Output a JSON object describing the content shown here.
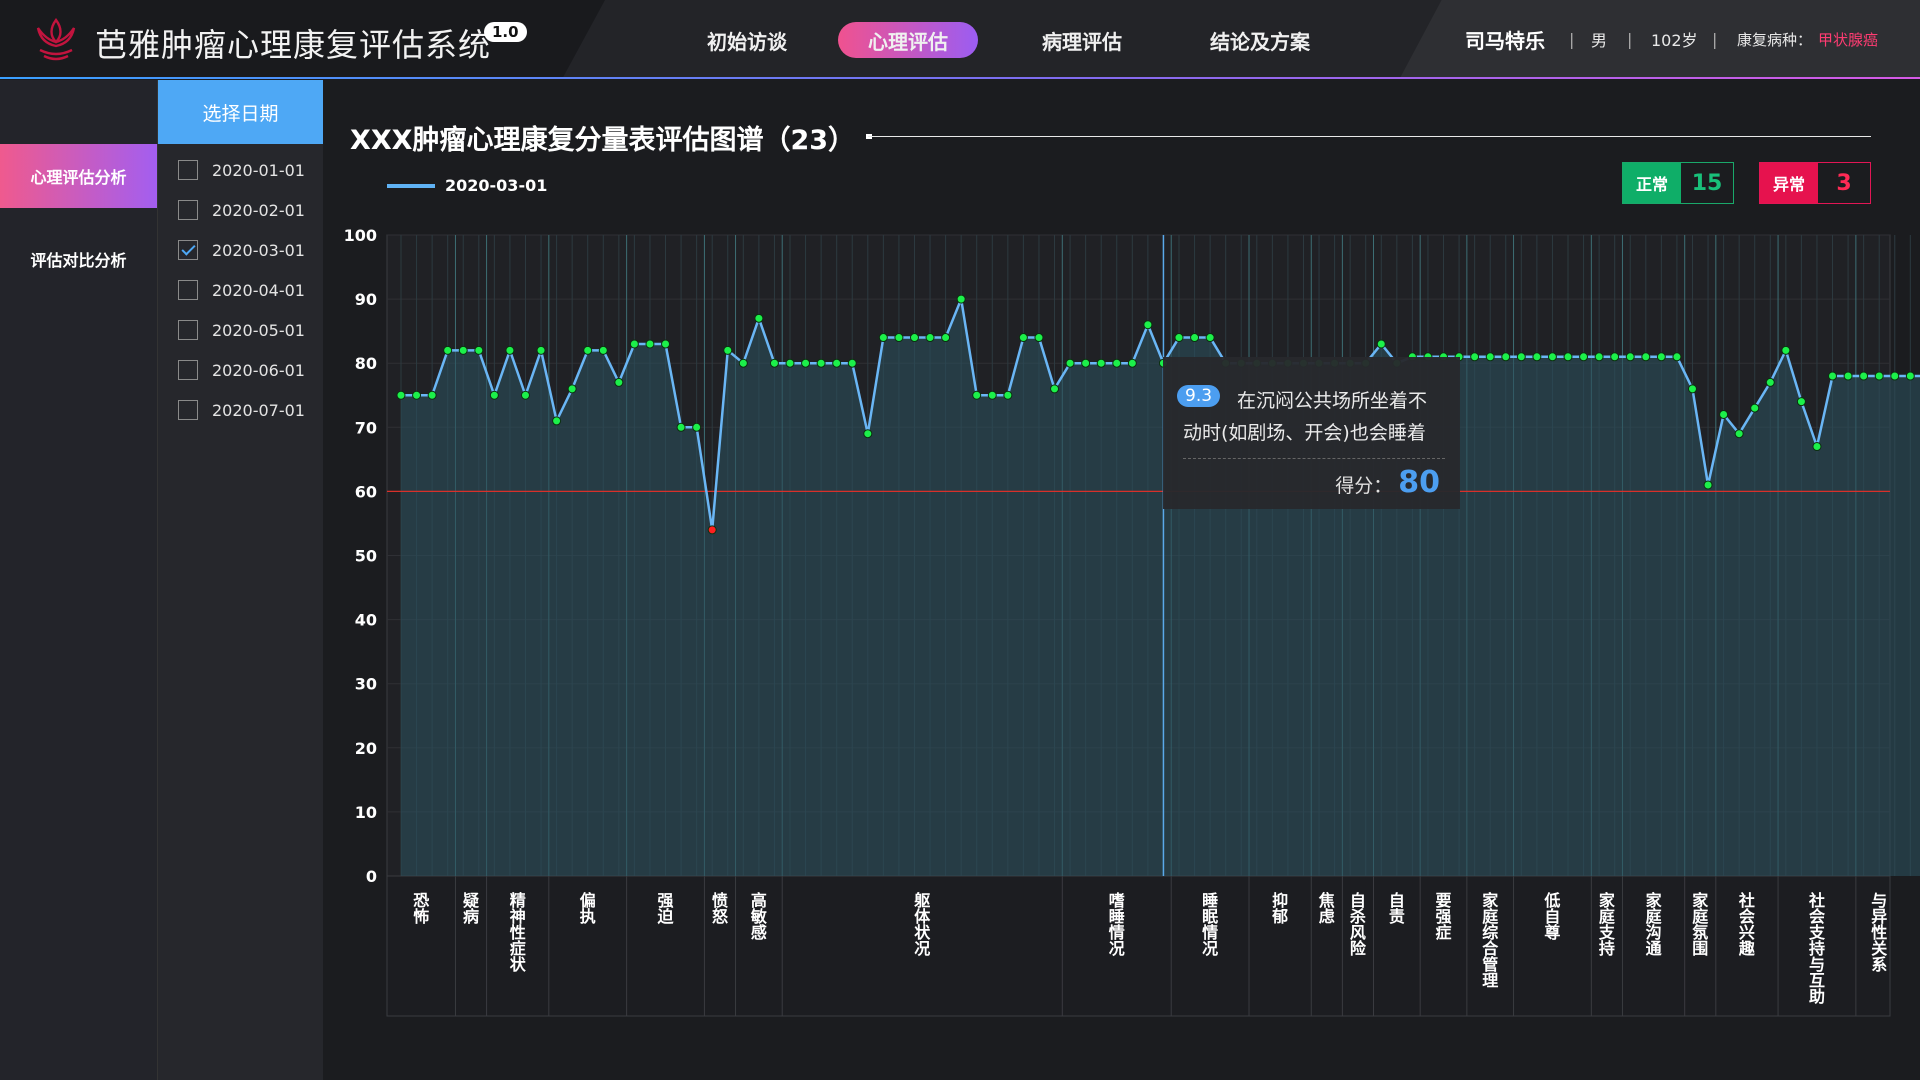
{
  "app": {
    "title": "芭雅肿瘤心理康复评估系统",
    "version": "1.0"
  },
  "nav": {
    "items": [
      {
        "label": "初始访谈",
        "active": false
      },
      {
        "label": "心理评估",
        "active": true
      },
      {
        "label": "病理评估",
        "active": false
      },
      {
        "label": "结论及方案",
        "active": false
      }
    ]
  },
  "patient": {
    "name": "司马特乐",
    "sex": "男",
    "age": "102岁",
    "disease_label": "康复病种：",
    "disease": "甲状腺癌",
    "sep": "|"
  },
  "sidebar": {
    "items": [
      {
        "label": "心理评估分析",
        "active": true
      },
      {
        "label": "评估对比分析",
        "active": false
      }
    ]
  },
  "dates": {
    "header": "选择日期",
    "items": [
      {
        "label": "2020-01-01",
        "checked": false
      },
      {
        "label": "2020-02-01",
        "checked": false
      },
      {
        "label": "2020-03-01",
        "checked": true
      },
      {
        "label": "2020-04-01",
        "checked": false
      },
      {
        "label": "2020-05-01",
        "checked": false
      },
      {
        "label": "2020-06-01",
        "checked": false
      },
      {
        "label": "2020-07-01",
        "checked": false
      }
    ]
  },
  "summary": {
    "normal_label": "正常",
    "normal_count": "15",
    "abnormal_label": "异常",
    "abnormal_count": "3"
  },
  "tooltip": {
    "item_no": "9.3",
    "text": "在沉闷公共场所坐着不动时(如剧场、开会)也会睡着",
    "score_label": "得分：",
    "score": "80"
  },
  "colors": {
    "line": "#6ab6f5",
    "point_normal": "#1cf04a",
    "point_abnormal": "#ff2020",
    "threshold": "#d8302a",
    "accent": "#4ea8f5"
  },
  "chart_data": {
    "type": "line",
    "title": "XXX肿瘤心理康复分量表评估图谱（23）",
    "series": [
      {
        "name": "2020-03-01",
        "values": [
          75,
          75,
          75,
          82,
          82,
          82,
          75,
          82,
          75,
          82,
          71,
          76,
          82,
          82,
          77,
          83,
          83,
          83,
          70,
          70,
          54,
          82,
          80,
          87,
          80,
          80,
          80,
          80,
          80,
          80,
          69,
          84,
          84,
          84,
          84,
          84,
          90,
          75,
          75,
          75,
          84,
          84,
          76,
          80,
          80,
          80,
          80,
          80,
          86,
          80,
          84,
          84,
          84,
          80,
          80,
          80,
          80,
          80,
          80,
          80,
          80,
          80,
          80,
          83,
          80,
          81,
          81,
          81,
          81,
          81,
          81,
          81,
          81,
          81,
          81,
          81,
          81,
          81,
          81,
          81,
          81,
          81,
          81,
          76,
          61,
          72,
          69,
          73,
          77,
          82,
          74,
          67,
          78,
          78,
          78,
          78,
          78,
          78,
          78,
          74,
          71,
          67
        ]
      }
    ],
    "threshold": 60,
    "ylim": [
      0,
      100
    ],
    "yticks": [
      0,
      10,
      20,
      30,
      40,
      50,
      60,
      70,
      80,
      90,
      100
    ],
    "categories": [
      {
        "label": "恐怖",
        "span": 4
      },
      {
        "label": "疑病",
        "span": 2
      },
      {
        "label": "精神性症状",
        "span": 4
      },
      {
        "label": "偏执",
        "span": 5
      },
      {
        "label": "强迫",
        "span": 5
      },
      {
        "label": "愤怒",
        "span": 2
      },
      {
        "label": "高敏感",
        "span": 3
      },
      {
        "label": "躯体状况",
        "span": 18
      },
      {
        "label": "嗜睡情况",
        "span": 7
      },
      {
        "label": "睡眠情况",
        "span": 5
      },
      {
        "label": "抑郁",
        "span": 4
      },
      {
        "label": "焦虑",
        "span": 2
      },
      {
        "label": "自杀风险",
        "span": 2
      },
      {
        "label": "自责",
        "span": 3
      },
      {
        "label": "要强症",
        "span": 3
      },
      {
        "label": "家庭综合管理",
        "span": 3
      },
      {
        "label": "低自尊",
        "span": 5
      },
      {
        "label": "家庭支持",
        "span": 2
      },
      {
        "label": "家庭沟通",
        "span": 4
      },
      {
        "label": "家庭氛围",
        "span": 2
      },
      {
        "label": "社会兴趣",
        "span": 4
      },
      {
        "label": "社会支持与互助",
        "span": 5
      },
      {
        "label": "与异性关系",
        "span": 3
      }
    ],
    "highlight_index": 49
  }
}
